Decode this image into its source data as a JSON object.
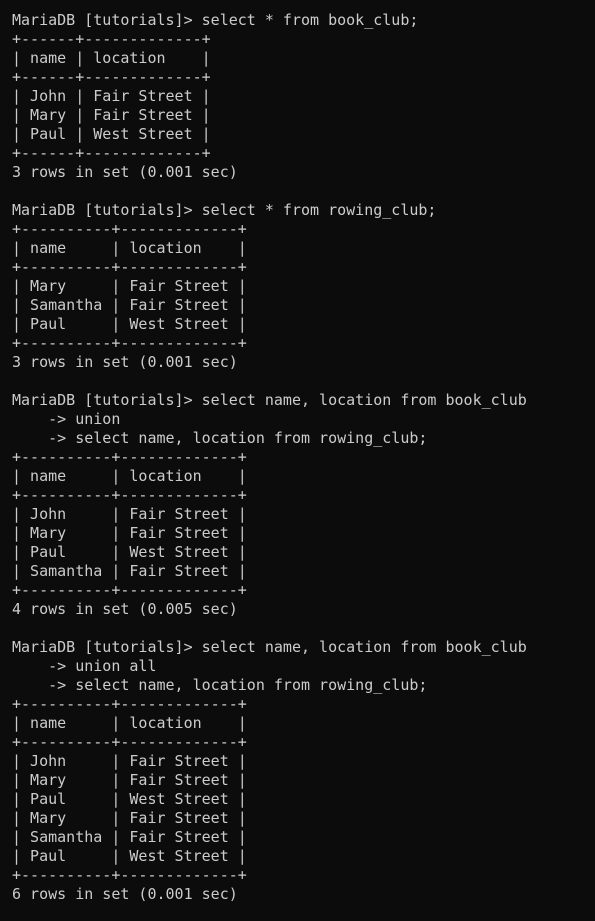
{
  "terminal": {
    "lines": [
      "MariaDB [tutorials]> select * from book_club;",
      "+------+-------------+",
      "| name | location    |",
      "+------+-------------+",
      "| John | Fair Street |",
      "| Mary | Fair Street |",
      "| Paul | West Street |",
      "+------+-------------+",
      "3 rows in set (0.001 sec)",
      "",
      "MariaDB [tutorials]> select * from rowing_club;",
      "+----------+-------------+",
      "| name     | location    |",
      "+----------+-------------+",
      "| Mary     | Fair Street |",
      "| Samantha | Fair Street |",
      "| Paul     | West Street |",
      "+----------+-------------+",
      "3 rows in set (0.001 sec)",
      "",
      "MariaDB [tutorials]> select name, location from book_club",
      "    -> union",
      "    -> select name, location from rowing_club;",
      "+----------+-------------+",
      "| name     | location    |",
      "+----------+-------------+",
      "| John     | Fair Street |",
      "| Mary     | Fair Street |",
      "| Paul     | West Street |",
      "| Samantha | Fair Street |",
      "+----------+-------------+",
      "4 rows in set (0.005 sec)",
      "",
      "MariaDB [tutorials]> select name, location from book_club",
      "    -> union all",
      "    -> select name, location from rowing_club;",
      "+----------+-------------+",
      "| name     | location    |",
      "+----------+-------------+",
      "| John     | Fair Street |",
      "| Mary     | Fair Street |",
      "| Paul     | West Street |",
      "| Mary     | Fair Street |",
      "| Samantha | Fair Street |",
      "| Paul     | West Street |",
      "+----------+-------------+",
      "6 rows in set (0.001 sec)"
    ]
  }
}
